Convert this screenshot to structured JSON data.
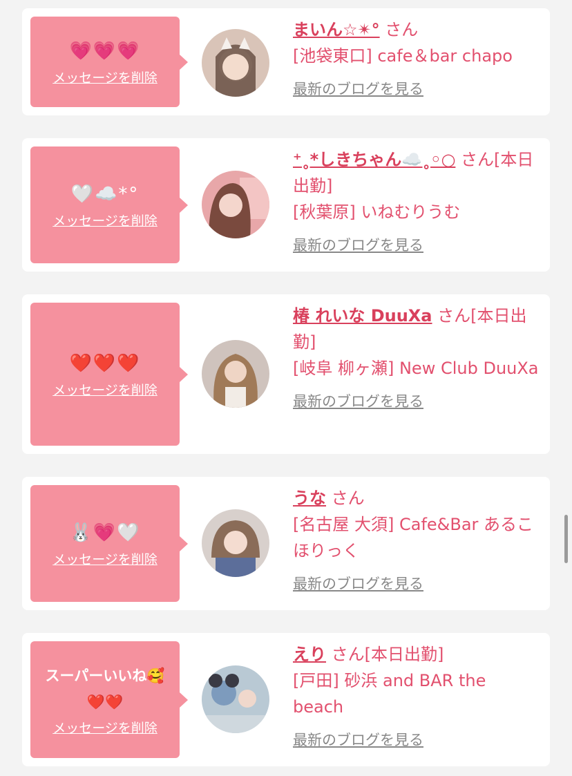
{
  "colors": {
    "background": "#f3f3f3",
    "card": "#ffffff",
    "bubble": "#f5919e",
    "accent_pink": "#e2506e",
    "link_gray": "#888888"
  },
  "delete_label": "メッセージを削除",
  "blog_label": "最新のブログを見る",
  "entries": [
    {
      "message": "💗💗💗",
      "name": "まいん☆✴︎°",
      "san": "さん",
      "place": "[池袋東口] cafe＆bar chapo"
    },
    {
      "message": "🤍☁️*°",
      "name": "⁺˳*しきちゃん☁️˳◦○",
      "san": "さん[本日出勤]",
      "place": "[秋葉原] いねむりうむ"
    },
    {
      "message": "❤️❤️❤️",
      "name": "椿 れいな DuuXa",
      "san": "さん[本日出勤]",
      "place": "[岐阜 柳ヶ瀬] New Club DuuXa"
    },
    {
      "message": "🐰💗🤍",
      "name": "うな",
      "san": "さん",
      "place": "[名古屋 大須] Cafe&Bar あるこほりっく"
    },
    {
      "message": "スーパーいいね🥰\n❤️❤️",
      "name": "えり",
      "san": "さん[本日出勤]",
      "place": "[戸田] 砂浜 and BAR the beach"
    }
  ]
}
